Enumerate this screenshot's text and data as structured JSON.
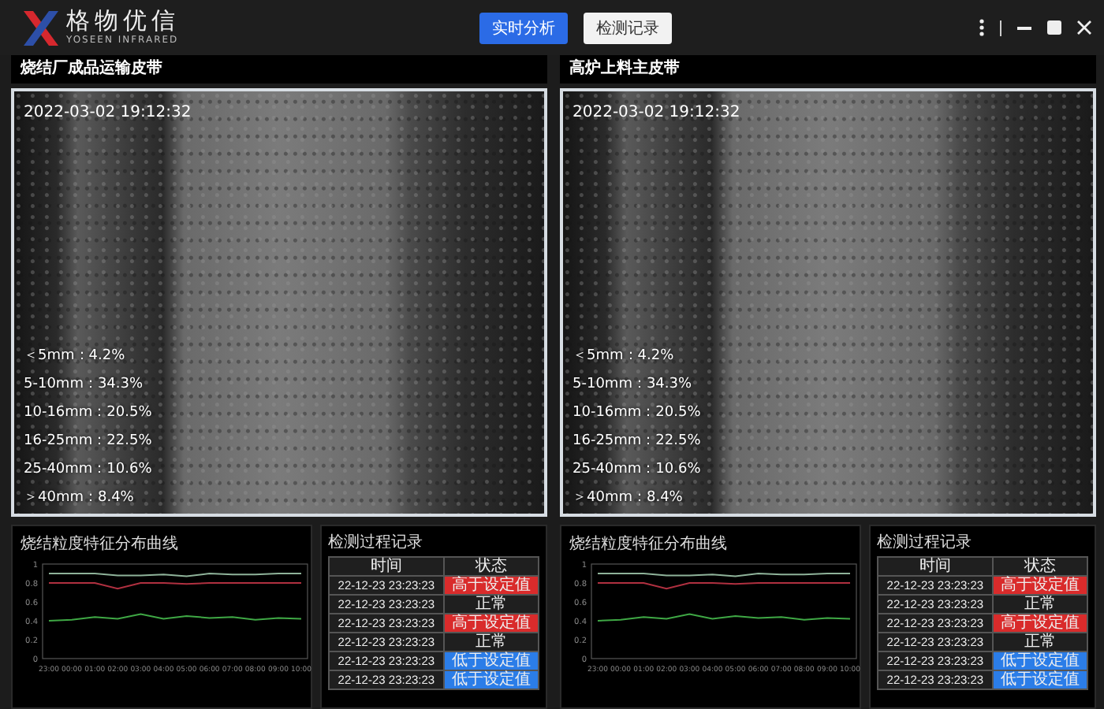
{
  "header": {
    "logo_text": "格物优信",
    "logo_subtext": "YOSEEN INFRARED",
    "nav": [
      {
        "label": "实时分析",
        "selected": true
      },
      {
        "label": "检测记录",
        "selected": false
      }
    ]
  },
  "panels": [
    {
      "title": "烧结厂成品运输皮带",
      "video": {
        "timestamp": "2022-03-02 19:12:32",
        "sizes": [
          "＜5mm：4.2%",
          "5-10mm：34.3%",
          "10-16mm：20.5%",
          "16-25mm：22.5%",
          "25-40mm：10.6%",
          "＞40mm：8.4%"
        ]
      },
      "chart_data": {
        "type": "line",
        "title": "烧结粒度特征分布曲线",
        "categories": [
          "23:00",
          "00:00",
          "01:00",
          "02:00",
          "03:00",
          "04:00",
          "05:00",
          "06:00",
          "07:00",
          "08:00",
          "09:00",
          "10:00"
        ],
        "ylim": [
          0,
          1
        ],
        "yticks": [
          0,
          0.2,
          0.4,
          0.6,
          0.8,
          1
        ],
        "series": [
          {
            "color": "#8fb39a",
            "values": [
              0.9,
              0.9,
              0.9,
              0.88,
              0.88,
              0.89,
              0.87,
              0.9,
              0.89,
              0.89,
              0.9,
              0.9
            ]
          },
          {
            "color": "#b03040",
            "values": [
              0.8,
              0.8,
              0.8,
              0.74,
              0.8,
              0.8,
              0.79,
              0.8,
              0.8,
              0.8,
              0.8,
              0.8
            ]
          },
          {
            "color": "#3fa845",
            "values": [
              0.4,
              0.41,
              0.44,
              0.42,
              0.47,
              0.42,
              0.45,
              0.43,
              0.44,
              0.41,
              0.43,
              0.42
            ]
          }
        ]
      },
      "records": {
        "title": "检测过程记录",
        "columns": [
          "时间",
          "状态"
        ],
        "rows": [
          {
            "time": "22-12-23 23:23:23",
            "status": "高于设定值",
            "kind": "high"
          },
          {
            "time": "22-12-23 23:23:23",
            "status": "正常",
            "kind": "normal"
          },
          {
            "time": "22-12-23 23:23:23",
            "status": "高于设定值",
            "kind": "high"
          },
          {
            "time": "22-12-23 23:23:23",
            "status": "正常",
            "kind": "normal"
          },
          {
            "time": "22-12-23 23:23:23",
            "status": "低于设定值",
            "kind": "low"
          },
          {
            "time": "22-12-23 23:23:23",
            "status": "低于设定值",
            "kind": "low"
          }
        ]
      }
    },
    {
      "title": "高炉上料主皮带",
      "video": {
        "timestamp": "2022-03-02 19:12:32",
        "sizes": [
          "＜5mm：4.2%",
          "5-10mm：34.3%",
          "10-16mm：20.5%",
          "16-25mm：22.5%",
          "25-40mm：10.6%",
          "＞40mm：8.4%"
        ]
      },
      "chart_data": {
        "type": "line",
        "title": "烧结粒度特征分布曲线",
        "categories": [
          "23:00",
          "00:00",
          "01:00",
          "02:00",
          "03:00",
          "04:00",
          "05:00",
          "06:00",
          "07:00",
          "08:00",
          "09:00",
          "10:00"
        ],
        "ylim": [
          0,
          1
        ],
        "yticks": [
          0,
          0.2,
          0.4,
          0.6,
          0.8,
          1
        ],
        "series": [
          {
            "color": "#8fb39a",
            "values": [
              0.9,
              0.9,
              0.9,
              0.88,
              0.88,
              0.89,
              0.87,
              0.9,
              0.89,
              0.89,
              0.9,
              0.9
            ]
          },
          {
            "color": "#b03040",
            "values": [
              0.8,
              0.8,
              0.8,
              0.74,
              0.8,
              0.8,
              0.79,
              0.8,
              0.8,
              0.8,
              0.8,
              0.8
            ]
          },
          {
            "color": "#3fa845",
            "values": [
              0.4,
              0.41,
              0.44,
              0.42,
              0.47,
              0.42,
              0.45,
              0.43,
              0.44,
              0.41,
              0.43,
              0.42
            ]
          }
        ]
      },
      "records": {
        "title": "检测过程记录",
        "columns": [
          "时间",
          "状态"
        ],
        "rows": [
          {
            "time": "22-12-23 23:23:23",
            "status": "高于设定值",
            "kind": "high"
          },
          {
            "time": "22-12-23 23:23:23",
            "status": "正常",
            "kind": "normal"
          },
          {
            "time": "22-12-23 23:23:23",
            "status": "高于设定值",
            "kind": "high"
          },
          {
            "time": "22-12-23 23:23:23",
            "status": "正常",
            "kind": "normal"
          },
          {
            "time": "22-12-23 23:23:23",
            "status": "低于设定值",
            "kind": "low"
          },
          {
            "time": "22-12-23 23:23:23",
            "status": "低于设定值",
            "kind": "low"
          }
        ]
      }
    }
  ]
}
